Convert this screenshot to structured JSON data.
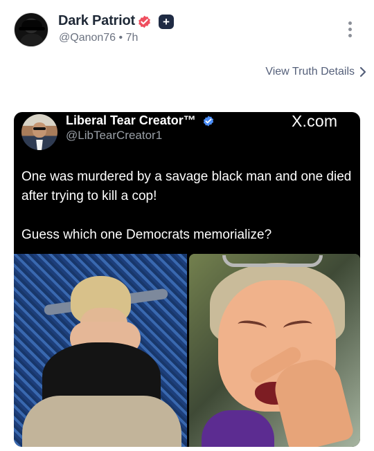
{
  "post": {
    "display_name": "Dark Patriot",
    "handle_time": "@Qanon76 • 7h",
    "badge_plus": "+",
    "view_details": "View Truth Details"
  },
  "embedded_post": {
    "display_name": "Liberal Tear Creator™",
    "handle": "@LibTearCreator1",
    "source": "X.com",
    "text_line1": "One was murdered by a savage black man and one died after trying to kill a cop!",
    "text_line2": "Guess which one Democrats memorialize?"
  },
  "icons": {
    "verified": "verified-badge-icon",
    "plus": "plus-badge-icon",
    "more": "more-options-icon",
    "chevron": "chevron-right-icon"
  },
  "colors": {
    "verified_badge": "#ef4f5f",
    "plus_badge": "#1f2b44",
    "link": "#55607a",
    "embed_background": "#000000",
    "embed_verified": "#4c8ef7"
  }
}
